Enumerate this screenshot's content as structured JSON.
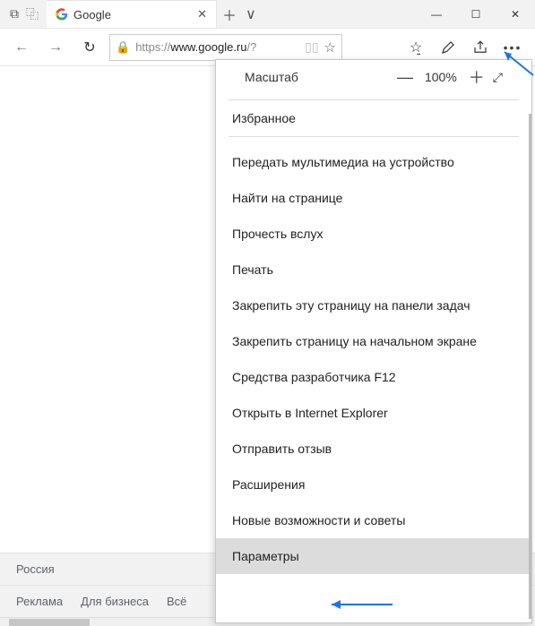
{
  "tab": {
    "title": "Google"
  },
  "url": {
    "prefix": "https://",
    "host": "www.google.ru",
    "path": "/?"
  },
  "zoom": {
    "label": "Масштаб",
    "value": "100%"
  },
  "menu": {
    "favorites": "Избранное",
    "items": [
      "Передать мультимедиа на устройство",
      "Найти на странице",
      "Прочесть вслух",
      "Печать",
      "Закрепить эту страницу на панели задач",
      "Закрепить страницу на начальном экране",
      "Средства разработчика F12",
      "Открыть в Internet Explorer",
      "Отправить отзыв",
      "Расширения",
      "Новые возможности и советы",
      "Параметры"
    ]
  },
  "footer": {
    "country": "Россия",
    "links": [
      "Реклама",
      "Для бизнеса",
      "Всё"
    ]
  }
}
